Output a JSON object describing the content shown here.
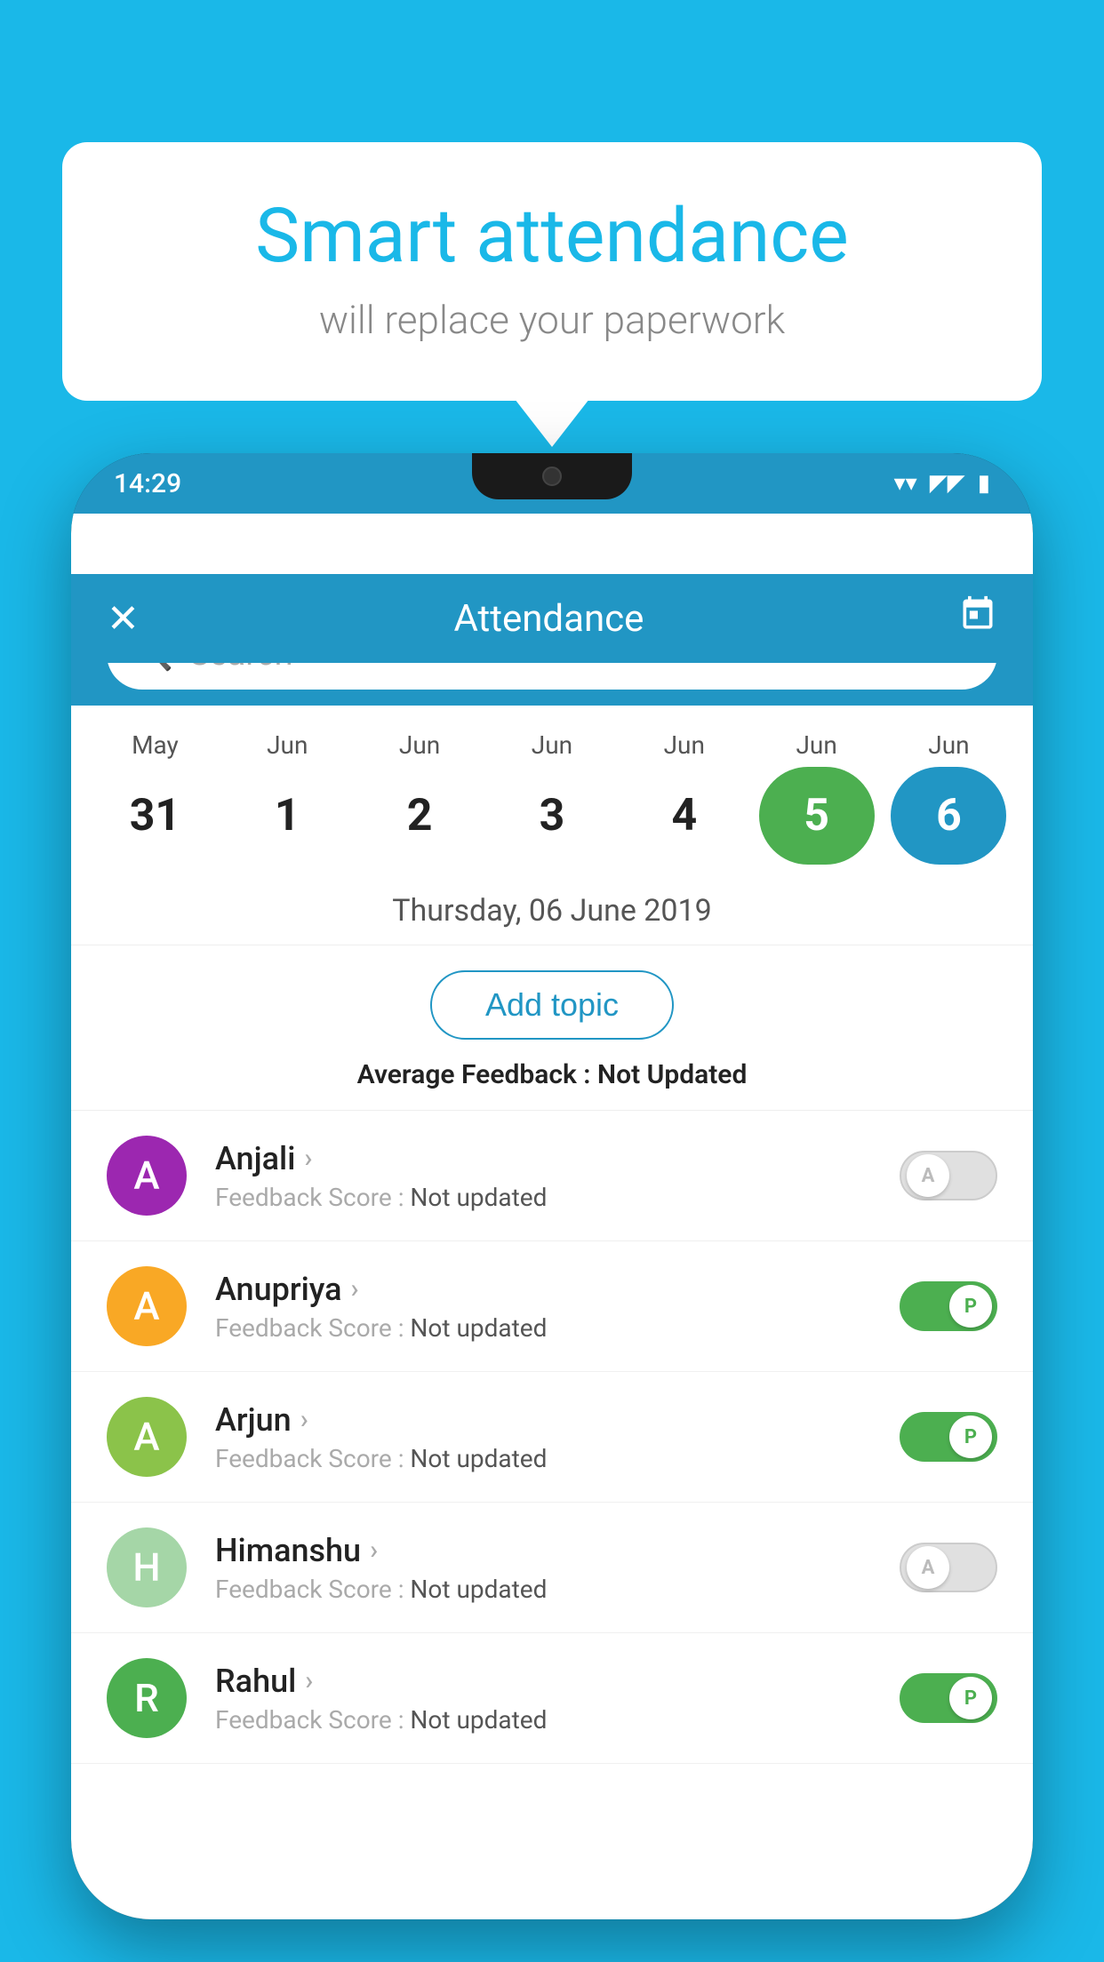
{
  "background_color": "#1ab8e8",
  "bubble": {
    "title": "Smart attendance",
    "subtitle": "will replace your paperwork"
  },
  "status_bar": {
    "time": "14:29",
    "wifi": "▼",
    "signal": "▲",
    "battery": "▮"
  },
  "app_bar": {
    "close_icon": "✕",
    "title": "Attendance",
    "calendar_icon": "calendar"
  },
  "search": {
    "placeholder": "Search"
  },
  "calendar": {
    "months": [
      "May",
      "Jun",
      "Jun",
      "Jun",
      "Jun",
      "Jun",
      "Jun"
    ],
    "dates": [
      "31",
      "1",
      "2",
      "3",
      "4",
      "5",
      "6"
    ],
    "states": [
      "normal",
      "normal",
      "normal",
      "normal",
      "normal",
      "today",
      "selected"
    ]
  },
  "selected_date_label": "Thursday, 06 June 2019",
  "add_topic_label": "Add topic",
  "average_feedback_label": "Average Feedback :",
  "average_feedback_value": "Not Updated",
  "students": [
    {
      "name": "Anjali",
      "feedback_label": "Feedback Score :",
      "feedback_value": "Not updated",
      "avatar_letter": "A",
      "avatar_color": "#9c27b0",
      "status": "absent"
    },
    {
      "name": "Anupriya",
      "feedback_label": "Feedback Score :",
      "feedback_value": "Not updated",
      "avatar_letter": "A",
      "avatar_color": "#f9a825",
      "status": "present"
    },
    {
      "name": "Arjun",
      "feedback_label": "Feedback Score :",
      "feedback_value": "Not updated",
      "avatar_letter": "A",
      "avatar_color": "#8bc34a",
      "status": "present"
    },
    {
      "name": "Himanshu",
      "feedback_label": "Feedback Score :",
      "feedback_value": "Not updated",
      "avatar_letter": "H",
      "avatar_color": "#a5d6a7",
      "status": "absent"
    },
    {
      "name": "Rahul",
      "feedback_label": "Feedback Score :",
      "feedback_value": "Not updated",
      "avatar_letter": "R",
      "avatar_color": "#4caf50",
      "status": "present"
    }
  ]
}
